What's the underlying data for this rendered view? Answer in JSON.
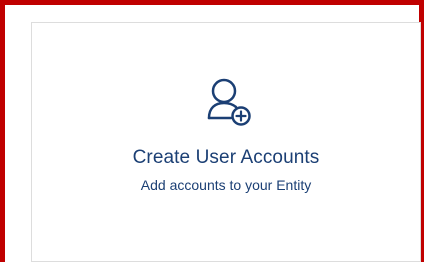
{
  "card": {
    "title": "Create User Accounts",
    "subtitle": "Add accounts to your Entity",
    "icon": "add-user-icon",
    "accent_color": "#1b3f74",
    "highlight_color": "#c00000"
  }
}
